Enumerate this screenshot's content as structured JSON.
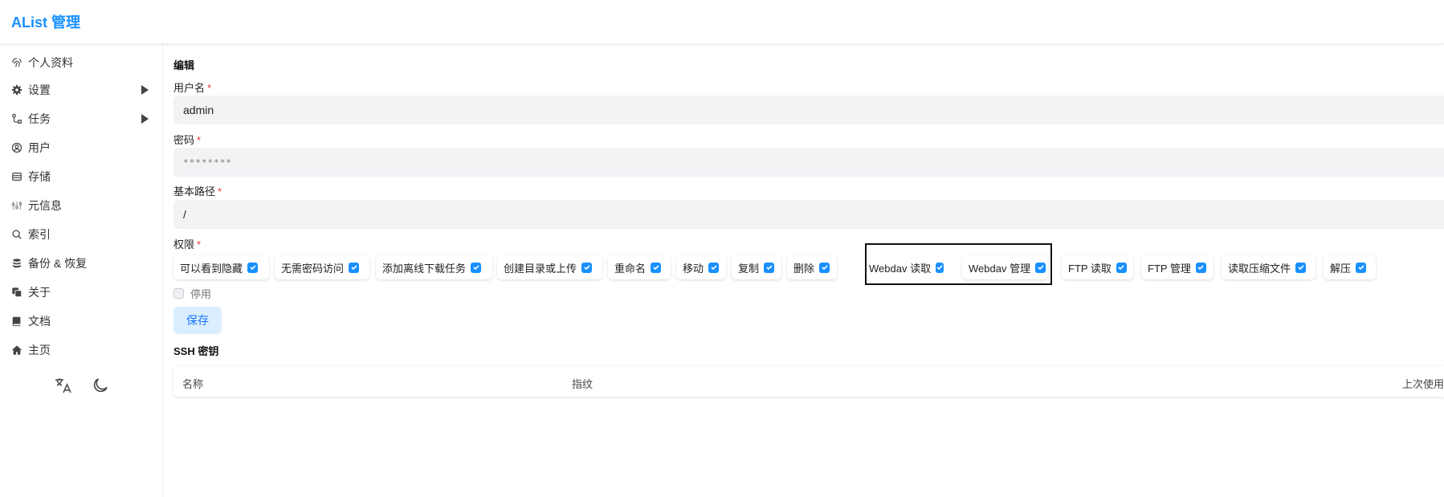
{
  "app": {
    "title": "AList 管理",
    "accent": "#1890ff"
  },
  "sidebar": {
    "items": [
      {
        "label": "个人资料",
        "icon": "fingerprint-icon"
      },
      {
        "label": "设置",
        "icon": "gear-icon",
        "expandable": true
      },
      {
        "label": "任务",
        "icon": "workflow-icon",
        "expandable": true
      },
      {
        "label": "用户",
        "icon": "user-circle-icon"
      },
      {
        "label": "存储",
        "icon": "database-drive-icon"
      },
      {
        "label": "元信息",
        "icon": "metadata-icon"
      },
      {
        "label": "索引",
        "icon": "search-icon"
      },
      {
        "label": "备份 & 恢复",
        "icon": "database-icon"
      },
      {
        "label": "关于",
        "icon": "copy-icon"
      },
      {
        "label": "文档",
        "icon": "book-icon"
      },
      {
        "label": "主页",
        "icon": "home-icon"
      }
    ],
    "tools": [
      {
        "icon": "translate-icon"
      },
      {
        "icon": "moon-icon"
      }
    ]
  },
  "form": {
    "section_title": "编辑",
    "username": {
      "label": "用户名",
      "value": "admin"
    },
    "password": {
      "label": "密码",
      "value": "********"
    },
    "base_path": {
      "label": "基本路径",
      "value": "/"
    },
    "required_mark": "*",
    "permissions_label": "权限",
    "permissions": [
      {
        "label": "可以看到隐藏",
        "checked": true
      },
      {
        "label": "无需密码访问",
        "checked": true
      },
      {
        "label": "添加离线下载任务",
        "checked": true
      },
      {
        "label": "创建目录或上传",
        "checked": true
      },
      {
        "label": "重命名",
        "checked": true
      },
      {
        "label": "移动",
        "checked": true
      },
      {
        "label": "复制",
        "checked": true
      },
      {
        "label": "删除",
        "checked": true
      },
      {
        "label": "Webdav 读取",
        "checked": true
      },
      {
        "label": "Webdav 管理",
        "checked": true
      },
      {
        "label": "FTP 读取",
        "checked": true
      },
      {
        "label": "FTP 管理",
        "checked": true
      },
      {
        "label": "读取压缩文件",
        "checked": true
      },
      {
        "label": "解压",
        "checked": true
      }
    ],
    "disable_label": "停用",
    "disable_checked": false,
    "save_label": "保存"
  },
  "ssh": {
    "title": "SSH 密钥",
    "columns": [
      "名称",
      "指纹",
      "上次使用"
    ]
  }
}
